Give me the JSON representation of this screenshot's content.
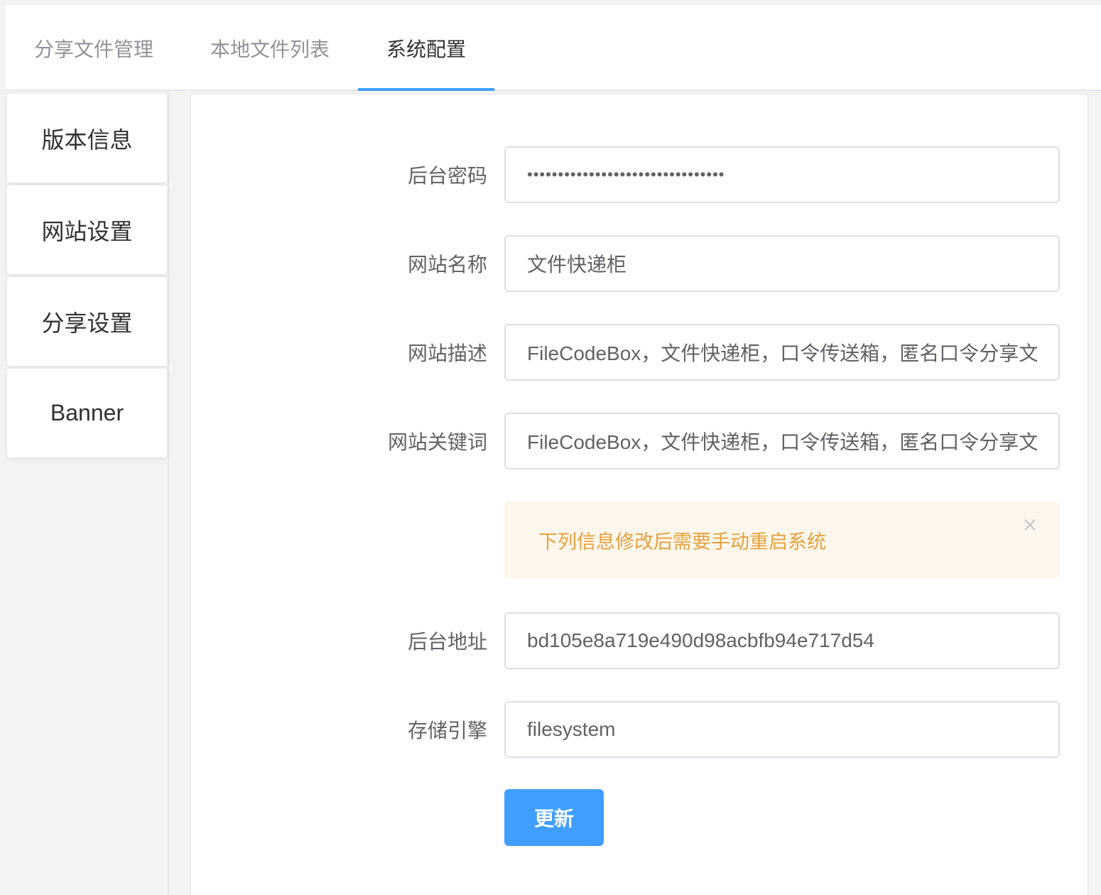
{
  "tabs": [
    {
      "label": "分享文件管理",
      "active": false
    },
    {
      "label": "本地文件列表",
      "active": false
    },
    {
      "label": "系统配置",
      "active": true
    }
  ],
  "side_menu": [
    {
      "label": "版本信息"
    },
    {
      "label": "网站设置"
    },
    {
      "label": "分享设置"
    },
    {
      "label": "Banner"
    }
  ],
  "form": {
    "password": {
      "label": "后台密码",
      "value": "••••••••••••••••••••••••••••••••"
    },
    "site_name": {
      "label": "网站名称",
      "value": "文件快递柜"
    },
    "site_description": {
      "label": "网站描述",
      "value": "FileCodeBox，文件快递柜，口令传送箱，匿名口令分享文"
    },
    "site_keywords": {
      "label": "网站关键词",
      "value": "FileCodeBox，文件快递柜，口令传送箱，匿名口令分享文"
    },
    "admin_address": {
      "label": "后台地址",
      "value": "bd105e8a719e490d98acbfb94e717d54"
    },
    "storage_engine": {
      "label": "存储引擎",
      "value": "filesystem"
    }
  },
  "alert": {
    "text": "下列信息修改后需要手动重启系统",
    "close_icon": "close-icon",
    "color": "#e6a23c",
    "background": "#fdf6ec"
  },
  "submit": {
    "label": "更新"
  },
  "colors": {
    "accent": "#409eff",
    "text_primary": "#303133",
    "text_secondary": "#909399"
  }
}
